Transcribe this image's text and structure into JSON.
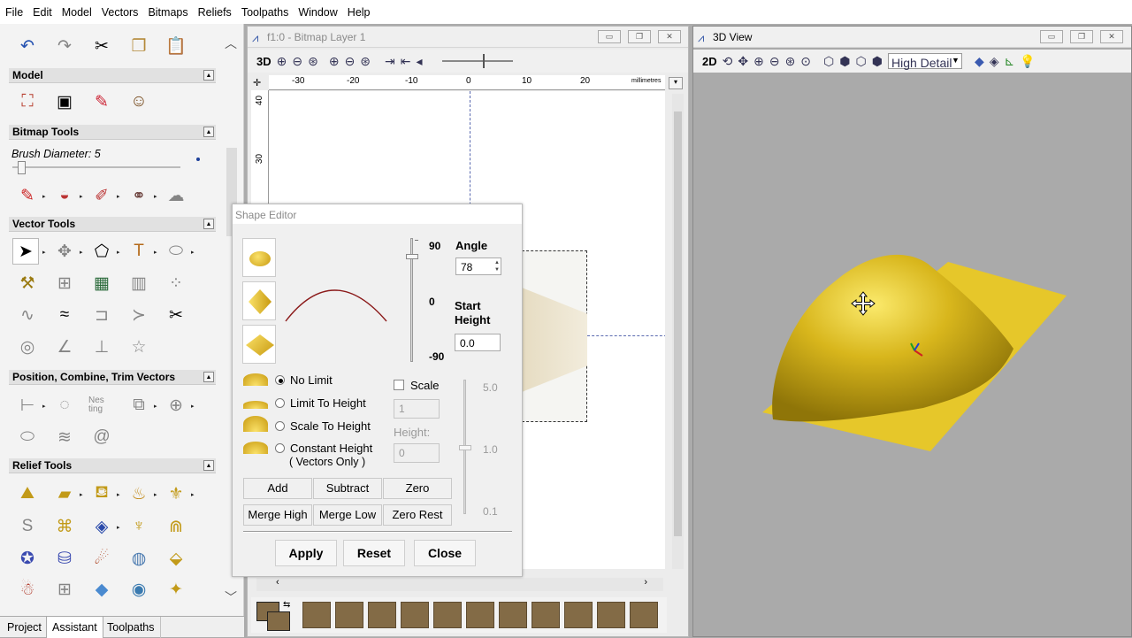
{
  "menu": [
    "File",
    "Edit",
    "Model",
    "Vectors",
    "Bitmaps",
    "Reliefs",
    "Toolpaths",
    "Window",
    "Help"
  ],
  "left_panel": {
    "sections": {
      "model": "Model",
      "bitmap_tools": "Bitmap Tools",
      "vector_tools": "Vector Tools",
      "position": "Position, Combine, Trim Vectors",
      "relief_tools": "Relief Tools"
    },
    "brush_label": "Brush Diameter:",
    "brush_value": "5",
    "nesting_label": "Nes ting",
    "tabs": [
      "Project",
      "Assistant",
      "Toolpaths"
    ]
  },
  "bitmap_window": {
    "title": "f1:0 - Bitmap Layer 1",
    "view_label": "3D",
    "ruler_top": [
      "-30",
      "-20",
      "-10",
      "0",
      "10",
      "20"
    ],
    "ruler_units": "millimetres",
    "ruler_left": [
      "40",
      "30"
    ]
  },
  "shape_editor": {
    "title": "Shape Editor",
    "angle_label": "Angle",
    "angle_value": "78",
    "slider_top": "90",
    "slider_mid": "0",
    "slider_bottom": "-90",
    "start_height_label": "Start Height",
    "start_height_value": "0.0",
    "options": [
      "No Limit",
      "Limit To Height",
      "Scale To Height",
      "Constant Height"
    ],
    "constant_sub": "( Vectors Only )",
    "selected_option": "No Limit",
    "scale_label": "Scale",
    "scale_value": "1",
    "height_label": "Height:",
    "height_value": "0",
    "scale_slider": [
      "5.0",
      "1.0",
      "0.1"
    ],
    "combine_row1": [
      "Add",
      "Subtract",
      "Zero"
    ],
    "combine_row2": [
      "Merge High",
      "Merge Low",
      "Zero Rest"
    ],
    "apply": "Apply",
    "reset": "Reset",
    "close": "Close"
  },
  "view3d": {
    "title": "3D View",
    "view_label": "2D",
    "detail": "High Detail"
  },
  "colors": {
    "relief": "#d8b61c",
    "plane": "#e6c72a",
    "swatch": "#836b46"
  }
}
